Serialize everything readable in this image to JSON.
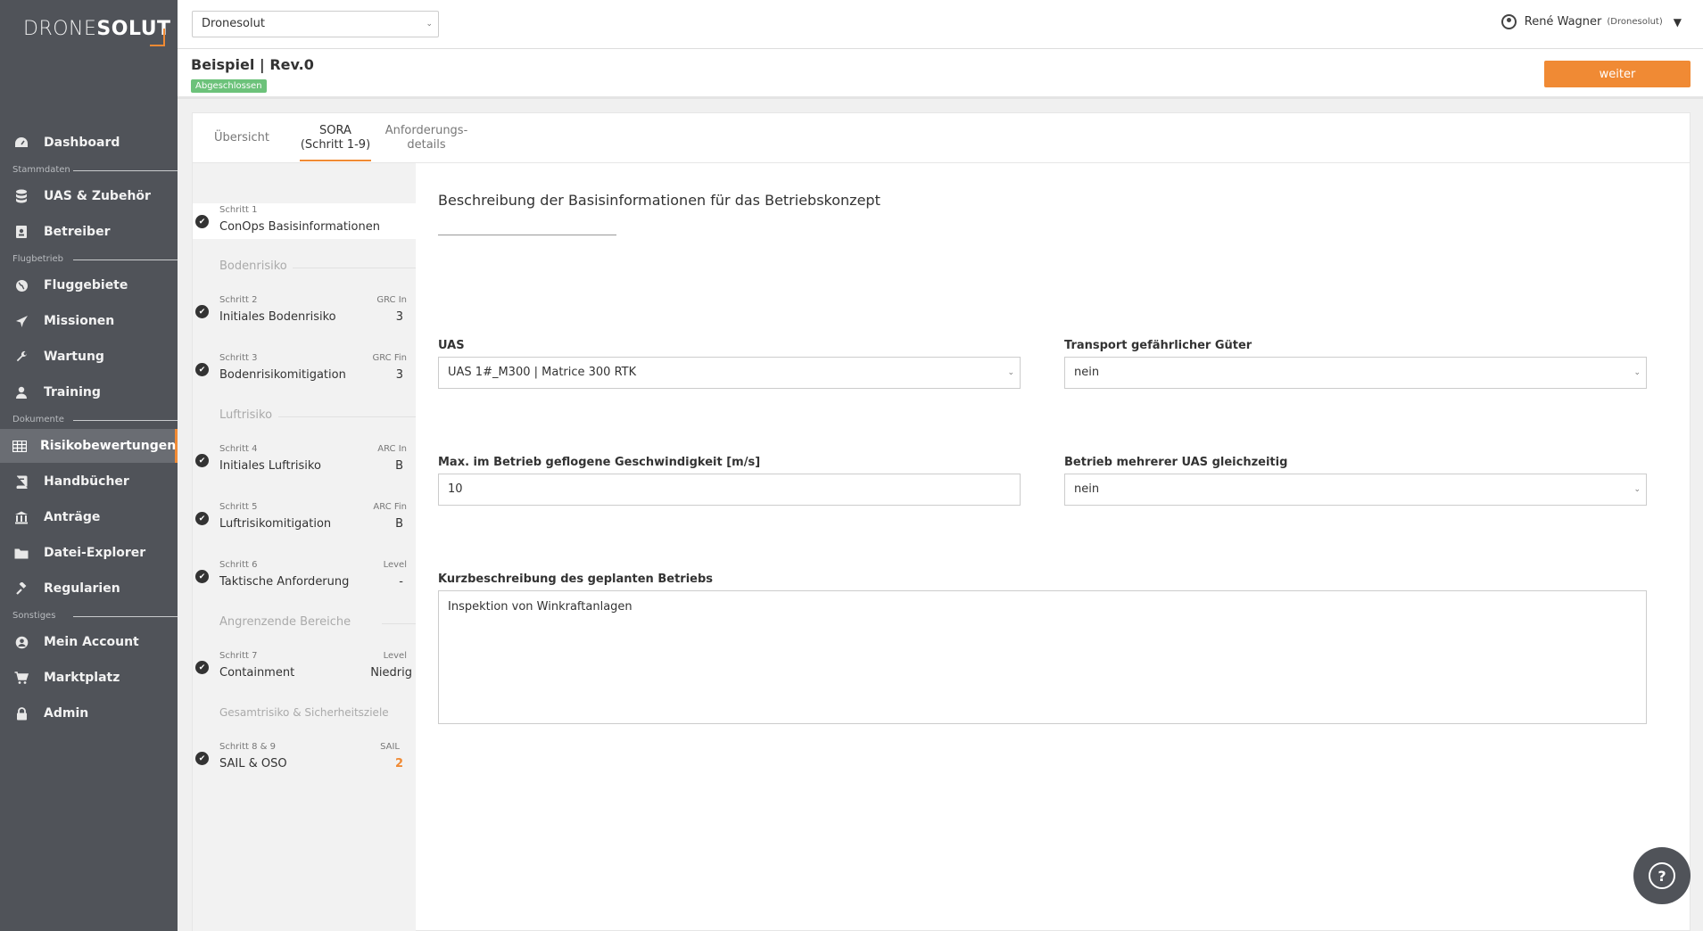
{
  "brand": {
    "light": "DRONE",
    "bold": "SOLUT"
  },
  "sidebar": {
    "items": [
      {
        "label": "Dashboard",
        "icon": "dashboard-icon"
      },
      {
        "label": "UAS & Zubehör",
        "icon": "database-icon"
      },
      {
        "label": "Betreiber",
        "icon": "id-card-icon"
      },
      {
        "label": "Fluggebiete",
        "icon": "globe-icon"
      },
      {
        "label": "Missionen",
        "icon": "plane-icon"
      },
      {
        "label": "Wartung",
        "icon": "wrench-icon"
      },
      {
        "label": "Training",
        "icon": "user-icon"
      },
      {
        "label": "Risikobewertungen",
        "icon": "table-icon"
      },
      {
        "label": "Handbücher",
        "icon": "book-icon"
      },
      {
        "label": "Anträge",
        "icon": "bank-icon"
      },
      {
        "label": "Datei-Explorer",
        "icon": "folder-icon"
      },
      {
        "label": "Regularien",
        "icon": "gavel-icon"
      },
      {
        "label": "Mein Account",
        "icon": "account-icon"
      },
      {
        "label": "Marktplatz",
        "icon": "cart-icon"
      },
      {
        "label": "Admin",
        "icon": "lock-icon"
      }
    ],
    "sections": [
      "Stammdaten",
      "Flugbetrieb",
      "Dokumente",
      "Sonstiges"
    ]
  },
  "header": {
    "org_select": "Dronesolut",
    "user_name": "René Wagner",
    "user_org": "(Dronesolut)"
  },
  "titlebar": {
    "title": "Beispiel | Rev.0",
    "status": "Abgeschlossen",
    "next_label": "weiter"
  },
  "tabs": [
    {
      "line1": "Übersicht",
      "line2": ""
    },
    {
      "line1": "SORA",
      "line2": "(Schritt 1-9)"
    },
    {
      "line1": "Anforderungs-",
      "line2": "details"
    }
  ],
  "steps": {
    "s1": {
      "num": "Schritt 1",
      "label": "ConOps Basisinformationen"
    },
    "g1": "Bodenrisiko",
    "s2": {
      "num": "Schritt 2",
      "label": "Initiales Bodenrisiko",
      "val_label": "GRC In",
      "val": "3"
    },
    "s3": {
      "num": "Schritt 3",
      "label": "Bodenrisikomitigation",
      "val_label": "GRC Fin",
      "val": "3"
    },
    "g2": "Luftrisiko",
    "s4": {
      "num": "Schritt 4",
      "label": "Initiales Luftrisiko",
      "val_label": "ARC In",
      "val": "B"
    },
    "s5": {
      "num": "Schritt 5",
      "label": "Luftrisikomitigation",
      "val_label": "ARC Fin",
      "val": "B"
    },
    "s6": {
      "num": "Schritt 6",
      "label": "Taktische Anforderung",
      "val_label": "Level",
      "val": "-"
    },
    "g3": "Angrenzende Bereiche",
    "s7": {
      "num": "Schritt 7",
      "label": "Containment",
      "val_label": "Level",
      "val": "Niedrig"
    },
    "g4": "Gesamtrisiko & Sicherheitsziele",
    "s8": {
      "num": "Schritt 8 & 9",
      "label": "SAIL & OSO",
      "val_label": "SAIL",
      "val": "2"
    }
  },
  "form": {
    "title": "Beschreibung der Basisinformationen für das Betriebskonzept",
    "uas_label": "UAS",
    "uas_value": "UAS 1#_M300 | Matrice 300 RTK",
    "transport_label": "Transport gefährlicher Güter",
    "transport_value": "nein",
    "speed_label": "Max. im Betrieb geflogene Geschwindigkeit [m/s]",
    "speed_value": "10",
    "multi_label": "Betrieb mehrerer UAS gleichzeitig",
    "multi_value": "nein",
    "desc_label": "Kurzbeschreibung des geplanten Betriebs",
    "desc_value": "Inspektion von Winkraftanlagen"
  },
  "colors": {
    "accent": "#f08a34",
    "sidebar": "#505359",
    "success": "#6cc27a"
  }
}
